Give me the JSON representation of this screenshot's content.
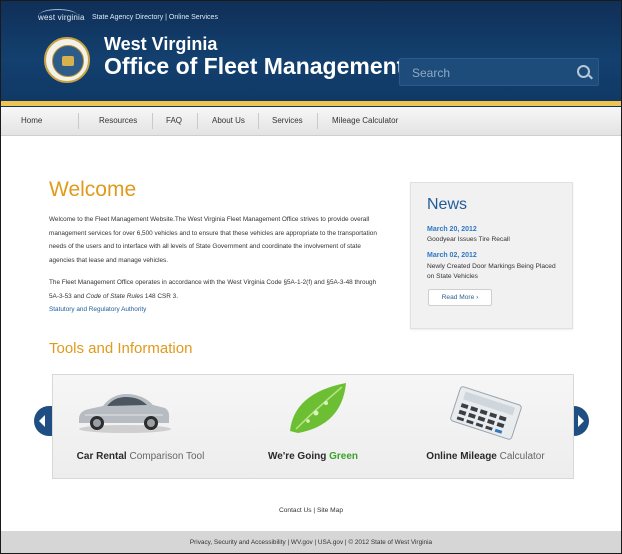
{
  "header": {
    "logo_text": "west virginia",
    "topnav": {
      "agency_directory": "State Agency Directory",
      "separator": " | ",
      "online_services": "Online Services"
    },
    "title_line1": "West Virginia",
    "title_line2": "Office of Fleet Management",
    "search_placeholder": "Search"
  },
  "nav": {
    "items": [
      {
        "label": "Home"
      },
      {
        "label": "Resources"
      },
      {
        "label": "FAQ"
      },
      {
        "label": "About Us"
      },
      {
        "label": "Services"
      },
      {
        "label": "Mileage Calculator"
      }
    ]
  },
  "welcome": {
    "title": "Welcome",
    "paragraph1": "Welcome to the Fleet Management Website.The West Virginia Fleet Management Office strives to provide overall management services for over 6,500 vehicles and to ensure that these vehicles are appropriate to the transportation needs of the users and to interface with all levels of State Government and coordinate the involvement of state agencies that lease and manage vehicles.",
    "paragraph2_a": "The Fleet Management Office operates in accordance with the West Virginia Code §5A-1-2(f) and §5A-3-48 through 5A-3-53 and ",
    "paragraph2_em": "Code of State Rules",
    "paragraph2_b": " 148 CSR 3.",
    "link": "Statutory and Regulatory Authority"
  },
  "news": {
    "title": "News",
    "items": [
      {
        "date": "March 20, 2012",
        "text": "Goodyear Issues Tire Recall"
      },
      {
        "date": "March 02, 2012",
        "text": "Newly Created Door Markings Being Placed on State Vehicles"
      }
    ],
    "read_more": "Read More ›"
  },
  "tools": {
    "title": "Tools and Information",
    "tiles": [
      {
        "label_bold": "Car Rental",
        "label_rest": " Comparison Tool"
      },
      {
        "label_bold": "We're Going ",
        "label_rest": "Green"
      },
      {
        "label_bold": "Online Mileage",
        "label_rest": " Calculator"
      }
    ]
  },
  "footer": {
    "links": {
      "contact": "Contact Us",
      "sep": " | ",
      "sitemap": "Site Map"
    },
    "privacy": "Privacy, Security and Accessibility",
    "wvgov": "WV.gov",
    "usagov": "USA.gov",
    "copyright": "© 2012 State of West Virginia",
    "sep": " | "
  },
  "colors": {
    "header_blue": "#13406f",
    "accent_gold": "#f0c451",
    "heading_orange": "#e09a1c",
    "link_blue": "#1f5c99"
  }
}
